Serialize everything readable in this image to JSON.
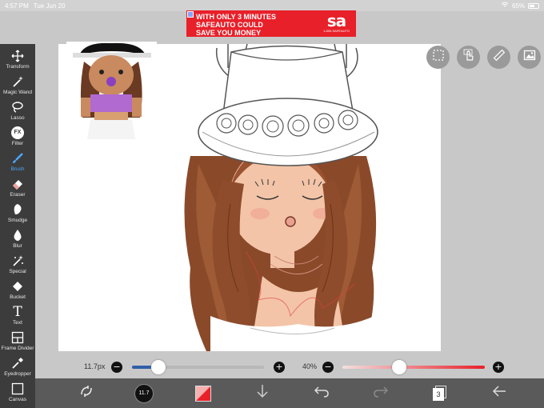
{
  "status_bar": {
    "time": "4:57 PM",
    "date": "Tue Jun 20",
    "battery": "65%"
  },
  "ad": {
    "line1": "WITH ONLY 3 MINUTES",
    "line2": "SAFEAUTO COULD",
    "line3": "SAVE YOU MONEY",
    "brand_mark": "sa",
    "brand_sub": "1-800-SAFEAUTO"
  },
  "tools": [
    {
      "label": "Transform",
      "icon": "move-arrows-icon"
    },
    {
      "label": "Magic Wand",
      "icon": "magic-wand-icon"
    },
    {
      "label": "Lasso",
      "icon": "lasso-icon"
    },
    {
      "label": "Filter",
      "icon": "fx-icon"
    },
    {
      "label": "Brush",
      "icon": "brush-icon"
    },
    {
      "label": "Eraser",
      "icon": "eraser-icon"
    },
    {
      "label": "Smudge",
      "icon": "smudge-icon"
    },
    {
      "label": "Blur",
      "icon": "drop-icon"
    },
    {
      "label": "Special",
      "icon": "special-wand-icon"
    },
    {
      "label": "Bucket",
      "icon": "bucket-icon"
    },
    {
      "label": "Text",
      "icon": "text-T-icon"
    },
    {
      "label": "Frame Divider",
      "icon": "frame-divider-icon"
    },
    {
      "label": "Eyedropper",
      "icon": "eyedropper-icon"
    },
    {
      "label": "Canvas",
      "icon": "canvas-icon"
    }
  ],
  "fx_glyph": "FX",
  "text_glyph": "T",
  "active_tool": "Brush",
  "brush_size": {
    "label": "11.7px",
    "minus": "−",
    "plus": "+",
    "value": 0.2
  },
  "opacity": {
    "label": "40%",
    "minus": "−",
    "plus": "+",
    "value": 0.4
  },
  "brush_preview_value": "11.7",
  "layer_count": "3",
  "colors": {
    "toolbar": "#3c3c3c",
    "active": "#4aa8ff",
    "size_track": "#2e5ea8",
    "opacity_track": "#e8202a",
    "ad": "#e8202a"
  }
}
